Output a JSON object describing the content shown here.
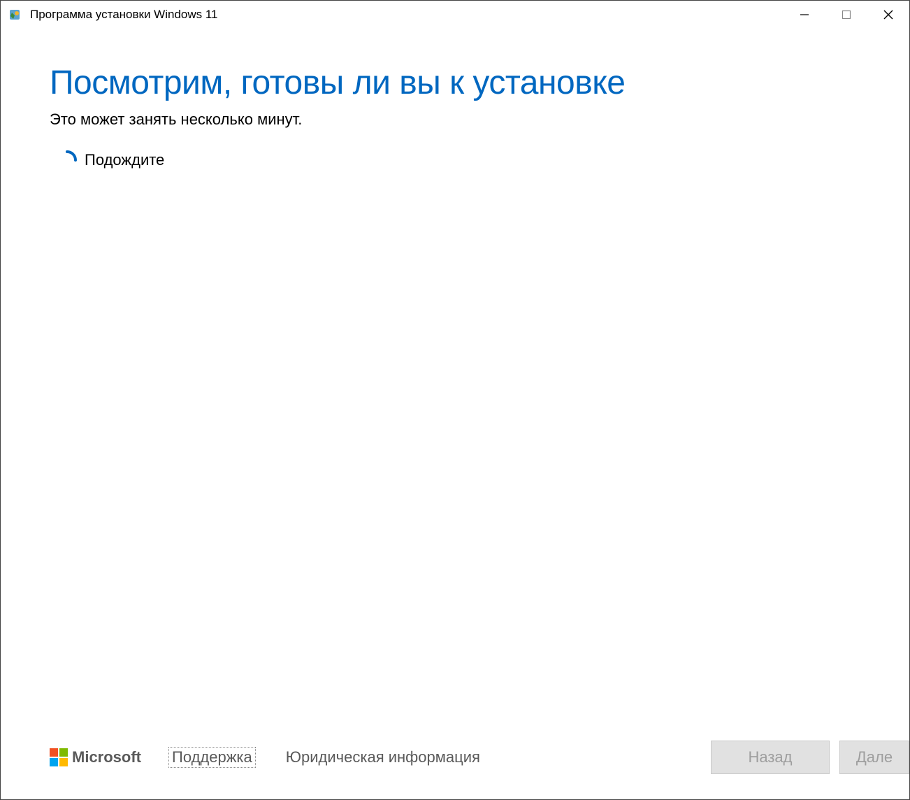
{
  "window": {
    "title": "Программа установки Windows 11"
  },
  "main": {
    "heading": "Посмотрим, готовы ли вы к установке",
    "subtitle": "Это может занять несколько минут.",
    "wait_label": "Подождите"
  },
  "footer": {
    "brand": "Microsoft",
    "support_link": "Поддержка",
    "legal_link": "Юридическая информация",
    "back_button": "Назад",
    "next_button": "Дале"
  },
  "colors": {
    "accent": "#0067c0",
    "ms_red": "#f25022",
    "ms_green": "#7fba00",
    "ms_blue": "#00a4ef",
    "ms_yellow": "#ffb900"
  }
}
